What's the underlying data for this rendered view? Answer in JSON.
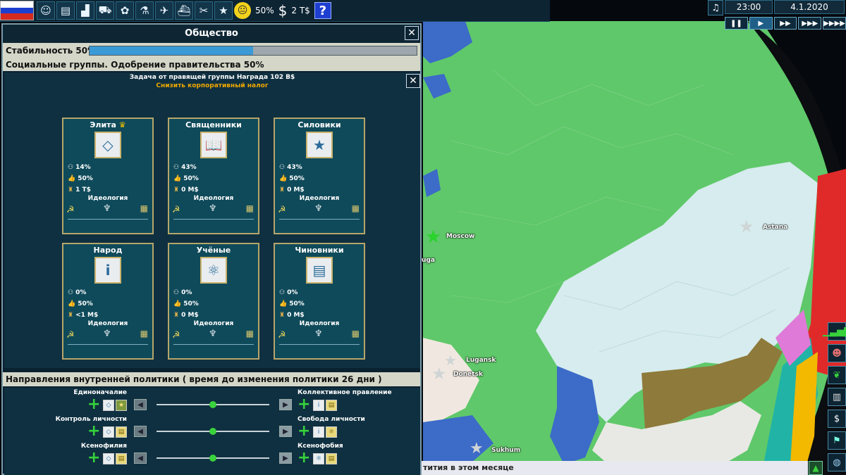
{
  "topbar": {
    "flag_colors": [
      "#ffffff",
      "#1c3fd0",
      "#d52b1e"
    ],
    "icons": [
      "population-icon",
      "economy-icon",
      "industry-icon",
      "shop-icon",
      "ecology-icon",
      "science-icon",
      "army-icon",
      "vehicles-icon",
      "tools-icon",
      "star-icon"
    ],
    "mood_percent": "50%",
    "money": "2 T$",
    "help": "?"
  },
  "clock": {
    "time": "23:00",
    "date": "4.1.2020",
    "speeds": [
      "❚❚",
      "▶",
      "▶▶",
      "▶▶▶",
      "▶▶▶▶"
    ]
  },
  "panel": {
    "title": "Общество",
    "close": "✕",
    "stability_label": "Стабильность 50%",
    "stability_value": 0.5,
    "social_groups_label": "Социальные группы. Одобрение правительства 50%",
    "task_title": "Задача от правящей группы Награда 102 B$",
    "task_subtitle": "Снизить корпоративный налог",
    "groups": [
      {
        "name": "Элита",
        "crown": "♛",
        "share": "14%",
        "approval": "50%",
        "money": "1 T$",
        "ideology": "Идеология",
        "icon": "◇"
      },
      {
        "name": "Священники",
        "share": "43%",
        "approval": "50%",
        "money": "0 M$",
        "ideology": "Идеология",
        "icon": "📖"
      },
      {
        "name": "Силовики",
        "share": "43%",
        "approval": "50%",
        "money": "0 M$",
        "ideology": "Идеология",
        "icon": "★"
      },
      {
        "name": "Народ",
        "share": "0%",
        "approval": "50%",
        "money": "<1 M$",
        "ideology": "Идеология",
        "icon": "i"
      },
      {
        "name": "Учёные",
        "share": "0%",
        "approval": "50%",
        "money": "0 M$",
        "ideology": "Идеология",
        "icon": "⚛"
      },
      {
        "name": "Чиновники",
        "share": "0%",
        "approval": "50%",
        "money": "0 M$",
        "ideology": "Идеология",
        "icon": "▤"
      }
    ],
    "policy_header": "Направления внутренней политики ( время до изменения политики 26 дни )",
    "policies": [
      {
        "left": "Единоначалие",
        "right": "Коллективное правление",
        "value": 0.5
      },
      {
        "left": "Контроль личности",
        "right": "Свобода личности",
        "value": 0.5
      },
      {
        "left": "Ксенофилия",
        "right": "Ксенофобия",
        "value": 0.5
      }
    ]
  },
  "map": {
    "cities": [
      "Moscow",
      "Astana",
      "Lugansk",
      "Donetsk",
      "Sukhum",
      "uga"
    ],
    "ticker": "тития в этом месяце"
  }
}
